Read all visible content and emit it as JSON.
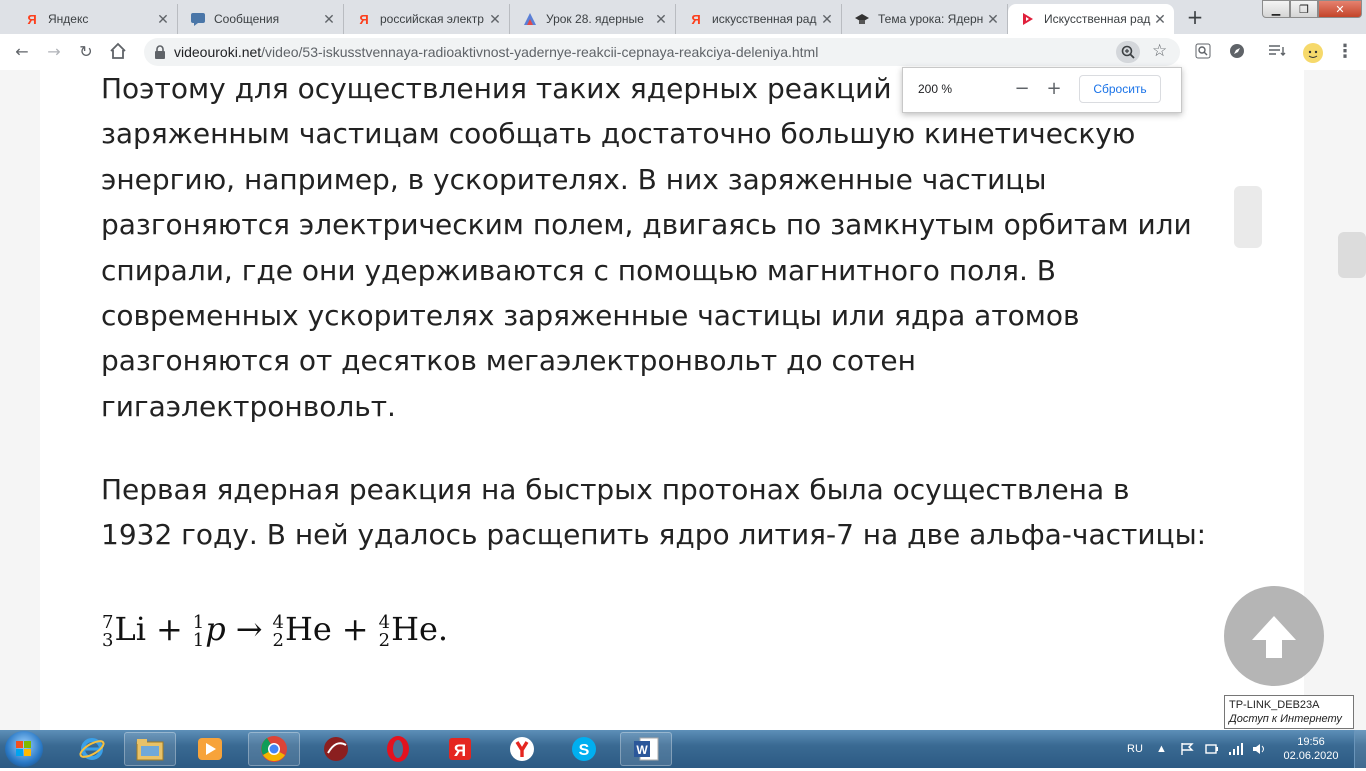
{
  "browser": {
    "tabs": [
      {
        "title": "Яндекс",
        "favicon": "yandex-icon",
        "active": false
      },
      {
        "title": "Сообщения",
        "favicon": "messages-icon",
        "active": false
      },
      {
        "title": "российская электр",
        "favicon": "yandex-icon",
        "active": false
      },
      {
        "title": "Урок 28. ядерные",
        "favicon": "lesson-icon",
        "active": false
      },
      {
        "title": "искусственная рад",
        "favicon": "yandex-icon",
        "active": false
      },
      {
        "title": "Тема урока: Ядерн",
        "favicon": "hat-icon",
        "active": false
      },
      {
        "title": "Искусственная рад",
        "favicon": "videouroki-icon",
        "active": true
      }
    ],
    "url_host": "videouroki.net",
    "url_path": "/video/53-iskusstvennaya-radioaktivnost-yadernye-reakcii-cepnaya-reakciya-deleniya.html",
    "zoom_popup": {
      "value": "200 %",
      "minus": "−",
      "plus": "+",
      "reset": "Сбросить"
    }
  },
  "article": {
    "paragraph1_lines": [
      "Поэтому для осуществления таких ядерных реакций",
      "заряженным частицам сообщать достаточно большую кинетическую",
      "энергию, например, в ускорителях.  В них заряженные частицы",
      "разгоняются электрическим полем, двигаясь по замкнутым орбитам или",
      "спирали, где они удерживаются с помощью магнитного поля. В",
      "современных ускорителях заряженные частицы или ядра атомов",
      "разгоняются от десятков мегаэлектронвольт до сотен",
      "гигаэлектронвольт."
    ],
    "paragraph2_lines": [
      "Первая ядерная реакция на быстрых протонах была осуществлена в",
      "1932 году. В ней удалось расщепить ядро лития-7 на две альфа-частицы:"
    ],
    "formula": {
      "terms": [
        {
          "mass": "7",
          "charge": "3",
          "symbol": "Li"
        },
        {
          "mass": "1",
          "charge": "1",
          "symbol": "p"
        },
        {
          "mass": "4",
          "charge": "2",
          "symbol": "He"
        },
        {
          "mass": "4",
          "charge": "2",
          "symbol": "He."
        }
      ],
      "ops": [
        "+",
        "→",
        "+"
      ]
    }
  },
  "tooltip": {
    "network": "TP-LINK_DEB23A",
    "status": "Доступ к Интернету"
  },
  "taskbar": {
    "apps": [
      "ie-icon",
      "explorer-icon",
      "media-player-icon",
      "chrome-icon",
      "unknown-app-icon",
      "opera-icon",
      "yandex-icon",
      "yandex-browser-icon",
      "skype-icon",
      "word-icon"
    ],
    "language": "RU",
    "time": "19:56",
    "date": "02.06.2020"
  },
  "colors": {
    "accent": "#1a73e8",
    "yandex_red": "#fc3f1d",
    "taskbar": "#3a6a93"
  }
}
